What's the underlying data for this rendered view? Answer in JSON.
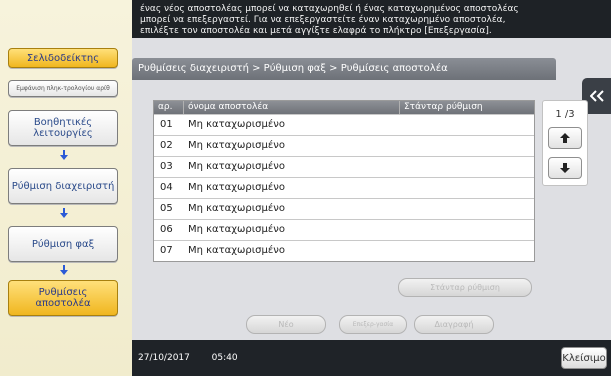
{
  "message": {
    "line1": "ένας νέος αποστολέας μπορεί να καταχωρηθεί ή ένας καταχωρημένος αποστολέας",
    "line2": "μπορεί να επεξεργαστεί. Για να επεξεργαστείτε έναν καταχωρημένο αποστολέα,",
    "line3": "επιλέξτε τον αποστολέα και μετά αγγίξτε ελαφρά το πλήκτρο [Επεξεργασία]."
  },
  "sidebar": {
    "bookmark": "Σελιδοδείκτης",
    "search": "Εμφάνιση πληκ-τρολογίου αρίθ",
    "items": [
      {
        "label": "Βοηθητικές λειτουργίες"
      },
      {
        "label": "Ρύθμιση διαχειριστή"
      },
      {
        "label": "Ρύθμιση φαξ"
      },
      {
        "label": "Ρυθμίσεις αποστολέα"
      }
    ]
  },
  "breadcrumb": "Ρυθμίσεις διαχειριστή > Ρύθμιση φαξ > Ρυθμίσεις αποστολέα",
  "table": {
    "headers": {
      "no": "αρ.",
      "name": "όνομα αποστολέα",
      "default": "Στάνταρ ρύθμιση"
    },
    "rows": [
      {
        "no": "01",
        "name": "Μη καταχωρισμένο"
      },
      {
        "no": "02",
        "name": "Μη καταχωρισμένο"
      },
      {
        "no": "03",
        "name": "Μη καταχωρισμένο"
      },
      {
        "no": "04",
        "name": "Μη καταχωρισμένο"
      },
      {
        "no": "05",
        "name": "Μη καταχωρισμένο"
      },
      {
        "no": "06",
        "name": "Μη καταχωρισμένο"
      },
      {
        "no": "07",
        "name": "Μη καταχωρισμένο"
      }
    ]
  },
  "pager": {
    "page": "1 /3"
  },
  "buttons": {
    "default_setting": "Στάνταρ ρύθμιση",
    "new": "Νέο",
    "edit": "Επεξερ-γασία",
    "delete": "Διαγραφή",
    "close": "Κλείσιμο"
  },
  "status": {
    "date": "27/10/2017",
    "time": "05:40"
  },
  "colors": {
    "accent_gold": "#f0b61f",
    "header_gray": "#7a7e85",
    "status_bar": "#1f2328"
  }
}
